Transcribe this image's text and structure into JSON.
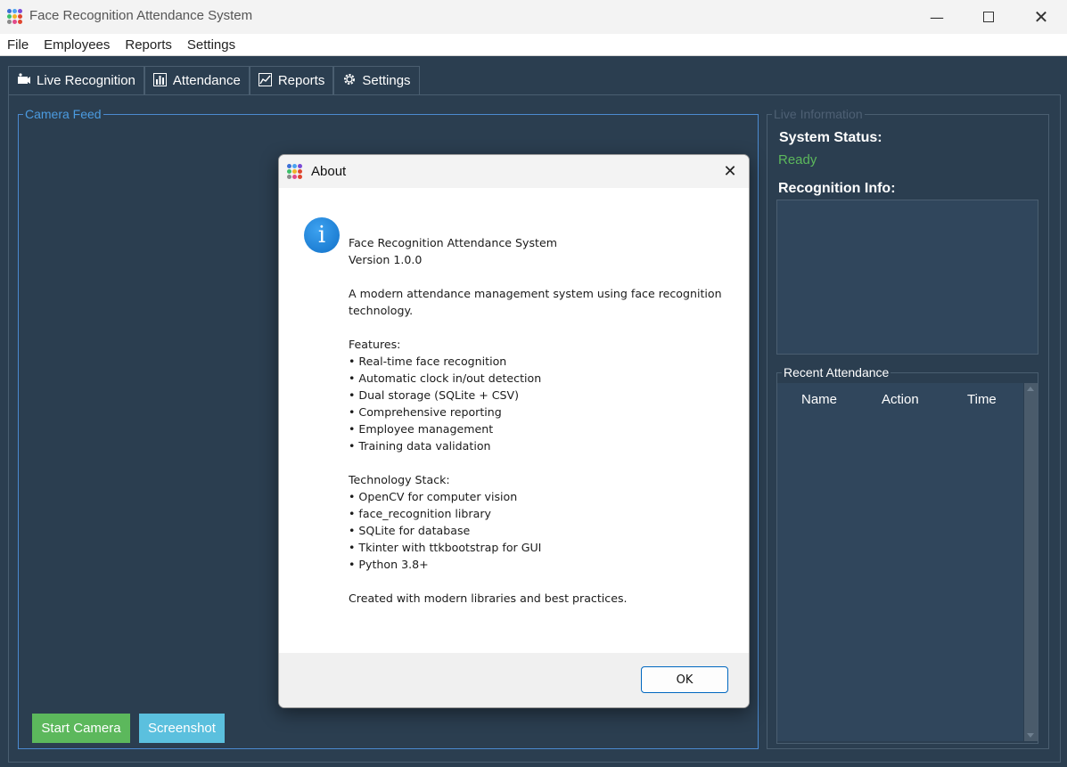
{
  "window": {
    "title": "Face Recognition Attendance System",
    "minimize_icon": "minimize-icon",
    "maximize_icon": "maximize-icon",
    "close_icon": "close-icon"
  },
  "menu": [
    "File",
    "Employees",
    "Reports",
    "Settings"
  ],
  "tabs": [
    {
      "label": "Live Recognition",
      "icon": "camera-icon"
    },
    {
      "label": "Attendance",
      "icon": "bar-chart-icon"
    },
    {
      "label": "Reports",
      "icon": "line-chart-icon"
    },
    {
      "label": "Settings",
      "icon": "gear-icon"
    }
  ],
  "camera": {
    "frame_label": "Camera Feed",
    "start_button": "Start Camera",
    "screenshot_button": "Screenshot"
  },
  "live_info": {
    "frame_label": "Live Information",
    "system_status_label": "System Status:",
    "system_status_value": "Ready",
    "recognition_info_label": "Recognition Info:",
    "recent_attendance_label": "Recent Attendance",
    "columns": [
      "Name",
      "Action",
      "Time"
    ]
  },
  "dialog": {
    "title": "About",
    "icon": "info-icon",
    "message": "Face Recognition Attendance System\nVersion 1.0.0\n\nA modern attendance management system using face recognition technology.\n\nFeatures:\n• Real-time face recognition\n• Automatic clock in/out detection\n• Dual storage (SQLite + CSV)\n• Comprehensive reporting\n• Employee management\n• Training data validation\n\nTechnology Stack:\n• OpenCV for computer vision\n• face_recognition library\n• SQLite for database\n• Tkinter with ttkbootstrap for GUI\n• Python 3.8+\n\nCreated with modern libraries and best practices.",
    "ok_button": "OK"
  },
  "colors": {
    "background": "#2b3e50",
    "accent_blue": "#4b9be0",
    "status_green": "#5cb85c",
    "start_button": "#5cb85c",
    "screenshot_button": "#5bc0de"
  }
}
